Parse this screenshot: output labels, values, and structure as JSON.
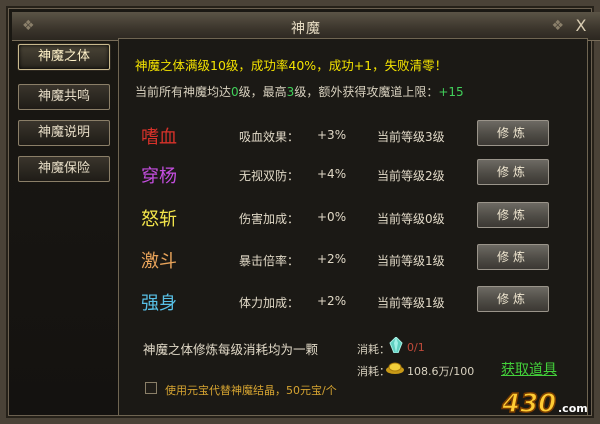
{
  "window": {
    "title": "神魔",
    "close_label": "X"
  },
  "sidebar": {
    "tabs": [
      {
        "label": "神魔之体",
        "active": true
      },
      {
        "label": "神魔共鸣",
        "active": false
      },
      {
        "label": "神魔说明",
        "active": false
      },
      {
        "label": "神魔保险",
        "active": false
      }
    ]
  },
  "main": {
    "hint": "神魔之体满级10级，成功率40%，成功+1，失败清零！",
    "summary": {
      "prefix": "当前所有神魔均达",
      "min_level": "0",
      "middle": "级，最高",
      "max_level": "3",
      "suffix": "级，额外获得攻魔道上限：",
      "bonus": "+15"
    },
    "abilities": [
      {
        "name": "嗜血",
        "color": "#d8322a",
        "effect_label": "吸血效果：",
        "effect_value": "+3%",
        "level_text": "当前等级3级",
        "button_label": "修炼"
      },
      {
        "name": "穿杨",
        "color": "#c54ee0",
        "effect_label": "无视双防：",
        "effect_value": "+4%",
        "level_text": "当前等级2级",
        "button_label": "修炼"
      },
      {
        "name": "怒斩",
        "color": "#f2e44a",
        "effect_label": "伤害加成：",
        "effect_value": "+0%",
        "level_text": "当前等级0级",
        "button_label": "修炼"
      },
      {
        "name": "激斗",
        "color": "#e8a35a",
        "effect_label": "暴击倍率：",
        "effect_value": "+2%",
        "level_text": "当前等级1级",
        "button_label": "修炼"
      },
      {
        "name": "强身",
        "color": "#58c0e6",
        "effect_label": "体力加成：",
        "effect_value": "+2%",
        "level_text": "当前等级1级",
        "button_label": "修炼"
      }
    ],
    "cost": {
      "description": "神魔之体修炼每级消耗均为一颗",
      "item1_label": "消耗：",
      "item1_icon": "crystal-icon",
      "item1_value": "0/1",
      "item2_label": "消耗：",
      "item2_icon": "gold-icon",
      "item2_value": "108.6万/100"
    },
    "get_item_link": "获取道具",
    "substitute_option": {
      "label": "使用元宝代替神魔结晶，50元宝/个",
      "checked": false
    }
  },
  "watermark": {
    "text": "430",
    "suffix": ".com"
  },
  "colors": {
    "hint": "#f4e300",
    "green": "#41d05a",
    "accent": "#c9b98e",
    "option": "#d6a431"
  }
}
